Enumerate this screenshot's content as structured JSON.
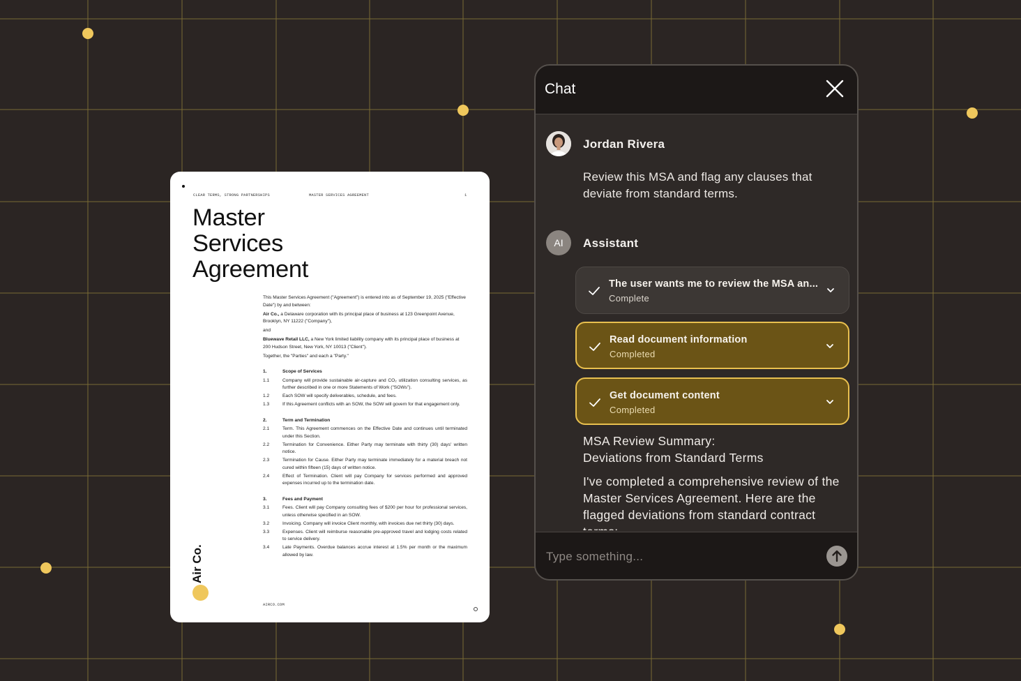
{
  "colors": {
    "background": "#2b2523",
    "grid": "#7a6a35",
    "accent": "#efc75c",
    "step_gold_bg": "#6b5416",
    "step_gold_border": "#e9c04f"
  },
  "document": {
    "header_left": "CLEAR TERMS, STRONG PARTNERSHIPS",
    "header_mid": "MASTER SERVICES AGREEMENT",
    "header_page": "1",
    "title_lines": [
      "Master",
      "Services",
      "Agreement"
    ],
    "intro": "This Master Services Agreement (\"Agreement\") is entered into as of September 19, 2025 (\"Effective Date\") by and between:",
    "party1_name": "Air Co.,",
    "party1_text": " a Delaware corporation with its principal place of business at 123 Greenpoint Avenue, Brooklyn, NY 11222 (\"Company\"),",
    "and": "and",
    "party2_name": "Bluewave Retail LLC,",
    "party2_text": " a New York limited liability company with its principal place of business at 200 Hudson Street, New York, NY 10013 (\"Client\").",
    "together": "Together, the \"Parties\" and each a \"Party.\"",
    "sections": [
      {
        "num": "1.",
        "heading": "Scope of Services",
        "items": [
          {
            "num": "1.1",
            "text": "Company will provide sustainable air-capture and CO₂ utilization consulting services, as further described in one or more Statements of Work (\"SOWs\")."
          },
          {
            "num": "1.2",
            "text": "Each SOW will specify deliverables, schedule, and fees."
          },
          {
            "num": "1.3",
            "text": "If this Agreement conflicts with an SOW, the SOW will govern for that engagement only."
          }
        ]
      },
      {
        "num": "2.",
        "heading": "Term and Termination",
        "items": [
          {
            "num": "2.1",
            "text": "Term. This Agreement commences on the Effective Date and continues until terminated under this Section."
          },
          {
            "num": "2.2",
            "text": "Termination for Convenience. Either Party may terminate with thirty (30) days' written notice."
          },
          {
            "num": "2.3",
            "text": "Termination for Cause. Either Party may terminate immediately for a material breach not cured within fifteen (15) days of written notice."
          },
          {
            "num": "2.4",
            "text": "Effect of Termination. Client will pay Company for services performed and approved expenses incurred up to the termination date."
          }
        ]
      },
      {
        "num": "3.",
        "heading": "Fees and Payment",
        "items": [
          {
            "num": "3.1",
            "text": "Fees. Client will pay Company consulting fees of $200 per hour for professional services, unless otherwise specified in an SOW."
          },
          {
            "num": "3.2",
            "text": "Invoicing. Company will invoice Client monthly, with invoices due net thirty (30) days."
          },
          {
            "num": "3.3",
            "text": "Expenses. Client will reimburse reasonable pre-approved travel and lodging costs related to service delivery."
          },
          {
            "num": "3.4",
            "text": "Late Payments. Overdue balances accrue interest at 1.5% per month or the maximum allowed by law."
          }
        ]
      }
    ],
    "footer": "AIRCO.COM",
    "brand": "Air Co."
  },
  "chat": {
    "title": "Chat",
    "close_icon": "close-icon",
    "user": {
      "name": "Jordan Rivera",
      "message": "Review this MSA and flag any clauses that deviate from standard terms."
    },
    "assistant": {
      "avatar": "AI",
      "name": "Assistant",
      "steps": [
        {
          "label": "The user wants me to review the MSA an...",
          "status": "Complete"
        },
        {
          "label": "Read document information",
          "status": "Completed"
        },
        {
          "label": "Get document content",
          "status": "Completed"
        }
      ],
      "summary_line1": "MSA Review Summary:",
      "summary_line2": "Deviations from Standard Terms",
      "body": "I've completed a comprehensive review of the Master Services Agreement. Here are the flagged deviations from standard contract terms:"
    },
    "input": {
      "placeholder": "Type something...",
      "value": ""
    },
    "send_icon": "arrow-up-icon"
  }
}
